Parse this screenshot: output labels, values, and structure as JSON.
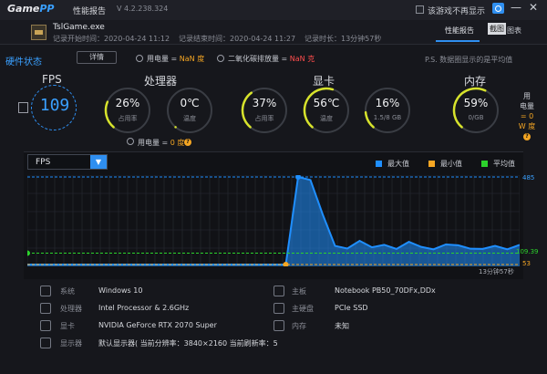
{
  "app": {
    "logo_game": "Game",
    "logo_pp": "PP",
    "title": "性能报告",
    "version": "V 4.2.238.324",
    "checkbox_label": "该游戏不再显示",
    "minimize": "—",
    "close": "✕"
  },
  "game": {
    "name": "TslGame.exe",
    "start_label": "记录开始时间：2020-04-24 11:12",
    "end_label": "记录结束时间：2020-04-24 11:27",
    "duration_label": "记录时长：13分钟57秒"
  },
  "tabs": {
    "report": "性能报告",
    "screenshot": "截图",
    "chart": "图表"
  },
  "hardware": {
    "title": "硬件状态",
    "detail_button": "详情",
    "power_text_prefix": "用电量 = ",
    "power_value": "NaN 度",
    "co2_text_prefix": "二氧化碳排放量 = ",
    "co2_value": "NaN 克",
    "note": "P.S. 数据圈显示的是平均值",
    "bottom_power_prefix": "用电量 = ",
    "bottom_power_value": "0 度"
  },
  "fps": {
    "title": "FPS",
    "value": "109"
  },
  "cpu": {
    "title": "处理器",
    "usage_value": "26%",
    "usage_label": "占用率",
    "usage_percent": 26,
    "temp_value": "0℃",
    "temp_label": "温度",
    "temp_percent": 0
  },
  "gpu": {
    "title": "显卡",
    "usage_value": "37%",
    "usage_label": "占用率",
    "usage_percent": 37,
    "temp_value": "56℃",
    "temp_label": "温度",
    "temp_percent": 56,
    "vram_value": "16%",
    "vram_label": "1.5/8 GB",
    "vram_percent": 16
  },
  "memory": {
    "title": "内存",
    "usage_value": "59%",
    "usage_label": "0/GB",
    "usage_percent": 59,
    "side_line1": "用",
    "side_line2": "电量",
    "side_line3": "= 0",
    "side_line4": "W 度"
  },
  "chart": {
    "selector": "FPS",
    "legend_max": "最大值",
    "legend_min": "最小值",
    "legend_avg": "平均值",
    "max_label": "485",
    "avg_label": "109.39",
    "min_label": "53",
    "duration": "13分钟57秒",
    "colors": {
      "max": "#1f8fff",
      "min": "#f5a623",
      "avg": "#2cd22c"
    }
  },
  "chart_data": {
    "type": "area",
    "title": "",
    "xlabel": "",
    "ylabel": "",
    "ylim": [
      53,
      485
    ],
    "series": [
      {
        "x": [
          0,
          1,
          2,
          3,
          4,
          5,
          6,
          7,
          8,
          9,
          10,
          11,
          12,
          13,
          14,
          15,
          16,
          17,
          18,
          19,
          20,
          21,
          22,
          23,
          24,
          25,
          26,
          27,
          28,
          29,
          30,
          31,
          32,
          33,
          34,
          35,
          36,
          37,
          38,
          39,
          40
        ],
        "values": [
          53,
          53,
          53,
          53,
          53,
          53,
          53,
          53,
          53,
          53,
          53,
          53,
          53,
          53,
          53,
          53,
          53,
          53,
          53,
          53,
          53,
          53,
          485,
          470,
          300,
          145,
          132,
          170,
          138,
          150,
          130,
          165,
          140,
          128,
          152,
          148,
          131,
          130,
          145,
          128,
          150
        ]
      }
    ],
    "max": 485,
    "min": 53,
    "average": 109.39
  },
  "system": {
    "os_label": "系统",
    "os_value": "Windows 10",
    "cpu_label": "处理器",
    "cpu_value": "Intel Processor & 2.6GHz",
    "gpu_label": "显卡",
    "gpu_value": "NVIDIA GeForce RTX 2070 Super",
    "display_label": "显示器",
    "display_value": "默认显示器( 当前分辨率：3840×2160 当前刷新率：5",
    "board_label": "主板",
    "board_value": "Notebook PB50_70DFx,DDx",
    "disk_label": "主硬盘",
    "disk_value": "PCIe SSD",
    "memory_label": "内存",
    "memory_value": "未知"
  }
}
